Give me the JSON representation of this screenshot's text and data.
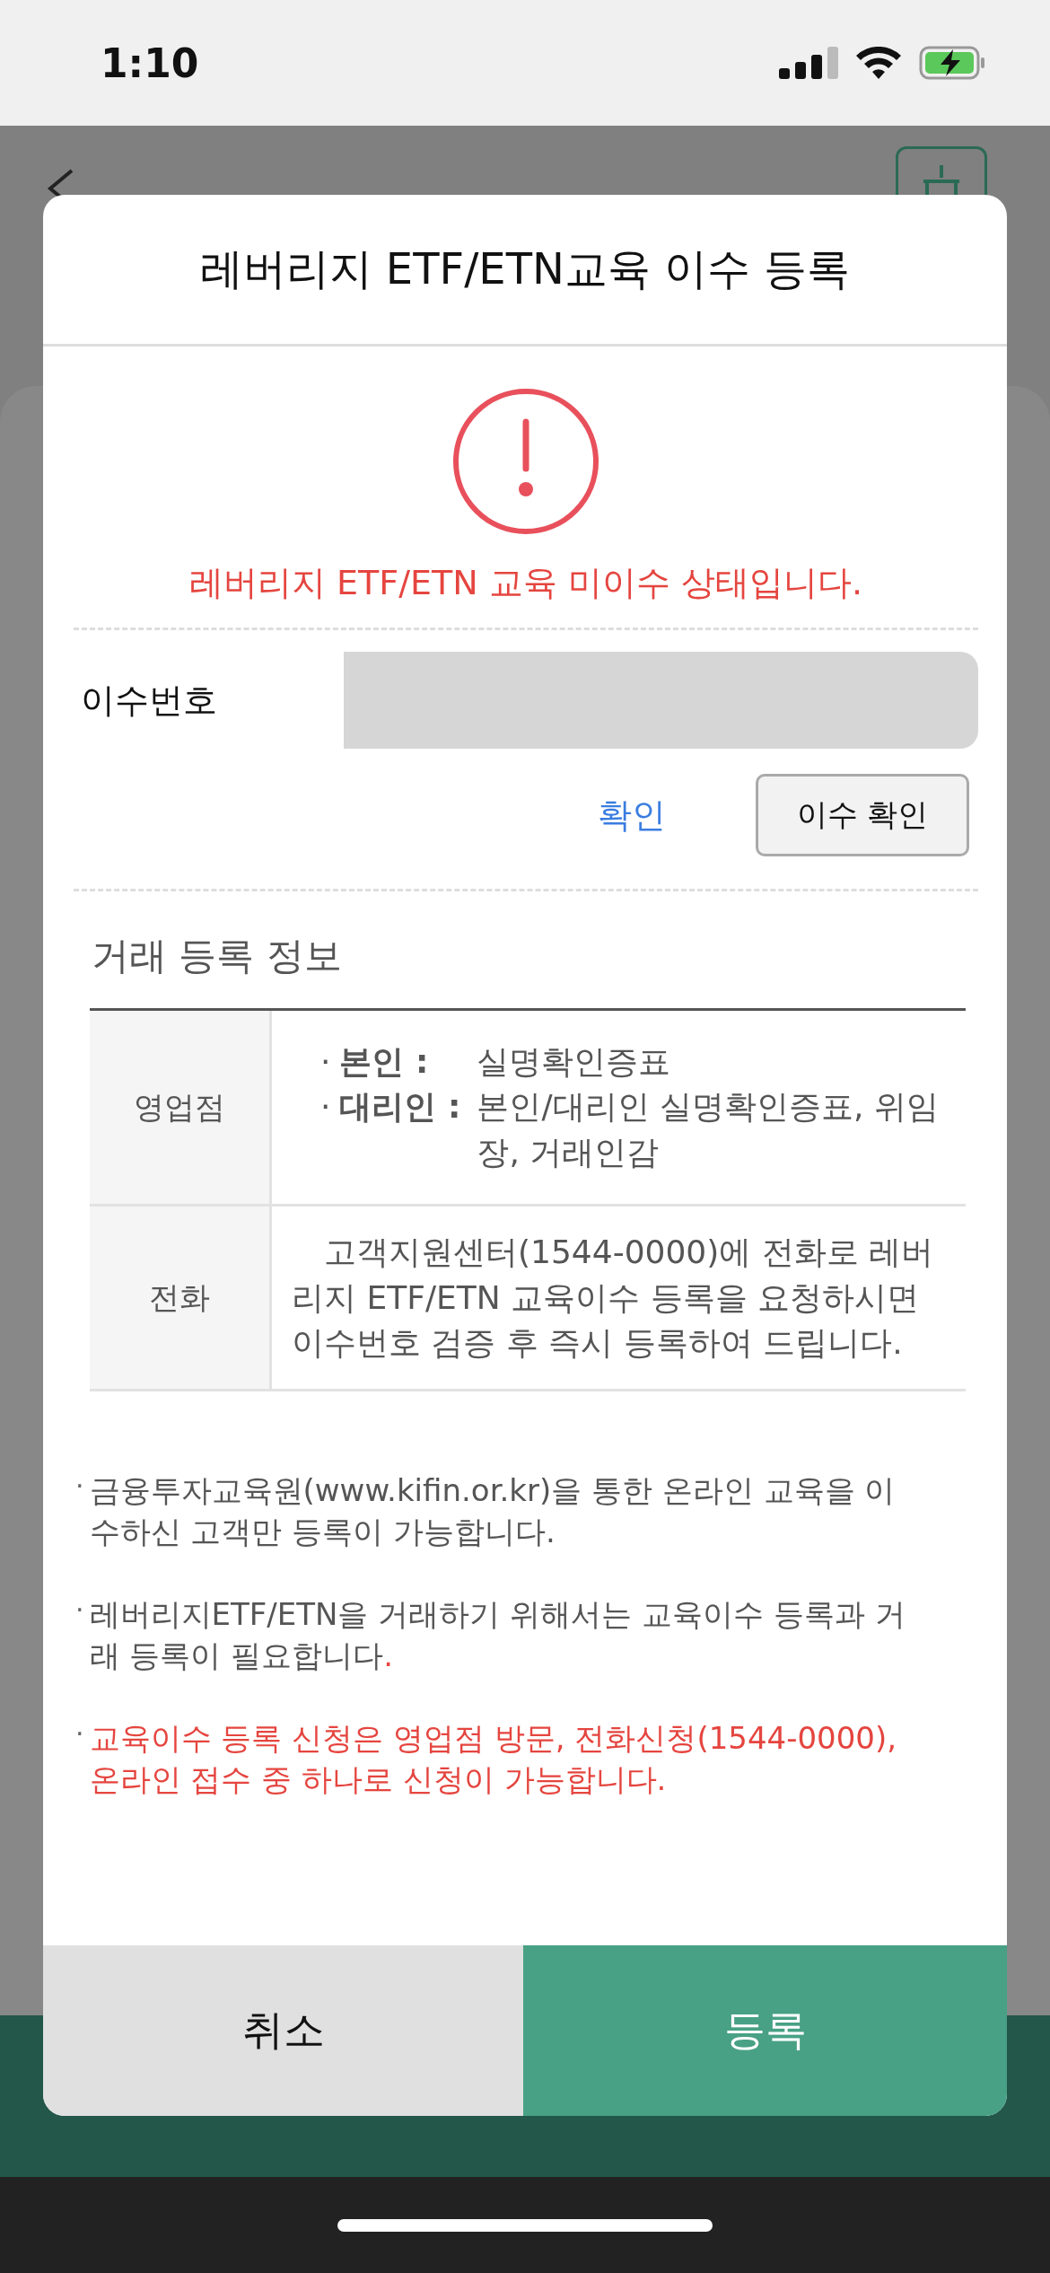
{
  "status_bar": {
    "time": "1:10"
  },
  "dialog": {
    "title": "레버리지 ETF/ETN교육 이수 등록",
    "alert": {
      "message": "레버리지 ETF/ETN 교육 미이수 상태입니다."
    },
    "completion_number": {
      "label": "이수번호",
      "value_masked": true
    },
    "confirm_link": "확인",
    "check_button": "이수 확인",
    "section_title": "거래 등록 정보",
    "table": {
      "rows": [
        {
          "header": "영업점",
          "kind": "list",
          "items": [
            {
              "marker": "·",
              "term": "본인 :",
              "value": "실명확인증표"
            },
            {
              "marker": "·",
              "term": "대리인 :",
              "value": "본인/대리인 실명확인증표, 위임장, 거래인감"
            }
          ]
        },
        {
          "header": "전화",
          "kind": "text",
          "text": "고객지원센터(1544-0000)에 전화로 레버리지 ETF/ETN 교육이수 등록을 요청하시면 이수번호 검증 후 즉시 등록하여 드립니다."
        }
      ]
    },
    "notes": [
      {
        "marker": "·",
        "parts": [
          {
            "text": "금융투자교육원(www.kifin.or.kr)을 통한 온라인 교육을 이수하신 고객만 등록이 가능합니다",
            "emphasis": false
          },
          {
            "text": ".",
            "emphasis": false
          }
        ]
      },
      {
        "marker": "·",
        "parts": [
          {
            "text": "레버리지ETF/ETN을 거래하기 위해서는 교육이수 등록과 거래 등록이 필요합니다",
            "emphasis": false
          },
          {
            "text": ".",
            "emphasis": true
          }
        ]
      },
      {
        "marker": "·",
        "parts": [
          {
            "text": "교육이수 등록 신청은 영업점 방문, 전화신청(1544-0000), 온라인 접수 중 하나로 신청이 가능합니다.",
            "emphasis": true
          }
        ]
      }
    ],
    "buttons": [
      {
        "label": "취소",
        "kind": "secondary"
      },
      {
        "label": "등록",
        "kind": "primary"
      }
    ]
  }
}
